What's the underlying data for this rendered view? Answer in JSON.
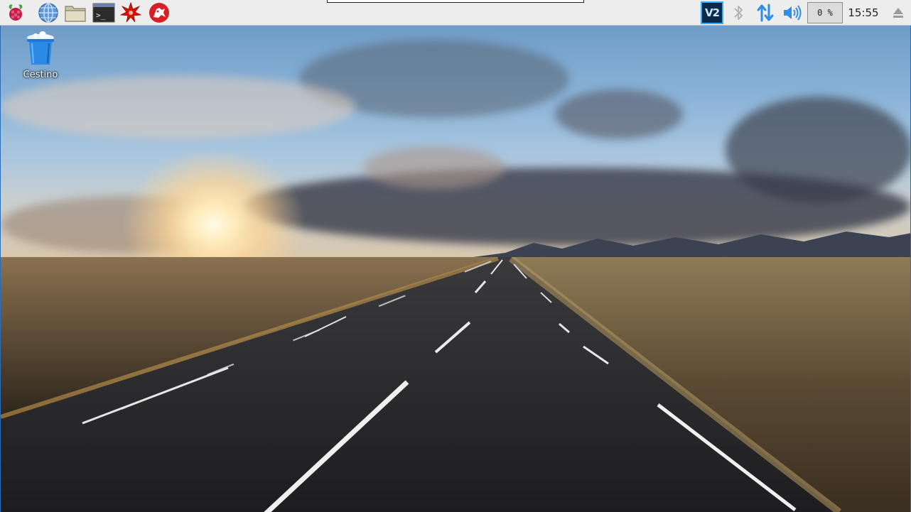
{
  "taskbar": {
    "launchers": [
      {
        "name": "raspberry-menu",
        "icon": "raspberry-icon"
      },
      {
        "name": "web-browser",
        "icon": "globe-icon"
      },
      {
        "name": "file-manager",
        "icon": "folder-icon"
      },
      {
        "name": "terminal",
        "icon": "terminal-icon"
      },
      {
        "name": "mathematica",
        "icon": "mathematica-icon"
      },
      {
        "name": "wolfram",
        "icon": "wolfram-icon"
      }
    ],
    "tray": {
      "vnc_label": "V2",
      "cpu_usage": "0 %",
      "clock": "15:55"
    }
  },
  "desktop": {
    "icons": [
      {
        "label": "Cestino",
        "icon": "trash-icon"
      }
    ]
  },
  "colors": {
    "taskbar_bg": "#ededed",
    "accent_blue": "#2e6db4",
    "vnc_border": "#39a9ff",
    "tray_blue": "#2c8ee6"
  }
}
